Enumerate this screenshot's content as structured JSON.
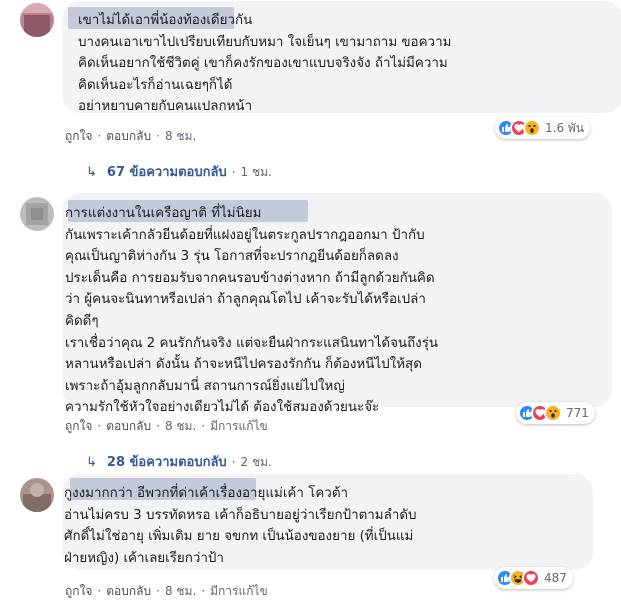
{
  "comments": [
    {
      "text": "เขาไม่ได้เอาพี่น้องท้องเดียวกัน\nบางคนเอาเขาไปเปรียบเทียบกับหมา ใจเย็นๆ เขามาถาม ขอความ\nคิดเห็นอยากใช้ชีวิตคู่ เขาก็คงรักของเขาแบบจริงจัง ถ้าไม่มีความ\nคิดเห็นอะไรก็อ่านเฉยๆก็ได้\nอย่าหยาบคายกับคนแปลกหน้า",
      "like": "ถูกใจ",
      "reply": "ตอบกลับ",
      "time": "8 ชม.",
      "edited": "",
      "reaction_count": "1.6 พัน",
      "reactions": [
        "like-icon",
        "love-icon",
        "wow-icon"
      ]
    },
    {
      "text": "การแต่งงานในเครือญาติ ที่ไม่นิยม\nกันเพราะเค้ากลัวยีนด้อยที่แฝงอยู่ในตระกูลปรากฎออกมา ป้ากับ\nคุณเป็นญาติห่างกัน 3 รุ่น โอกาสที่จะปรากฎยีนด้อยก็ลดลง\nประเด็นคือ การยอมรับจากคนรอบข้างต่างหาก ถ้ามีลูกด้วยกันคิด\nว่า ผู้คนจะนินทาหรือเปล่า ถ้าลูกคุณโตไป เค้าจะรับได้หรือเปล่า\nคิดดีๆ\nเราเชื่อว่าคุณ 2 คนรักกันจริง แต่จะยืนฝ่ากระแสนินทาได้จนถึงรุ่น\nหลานหรือเปล่า ดังนั้น ถ้าจะหนีไปครองรักกัน ก็ต้องหนีไปให้สุด\nเพราะถ้าอุ้มลูกกลับมานี่ สถานการณ์ยิ่งแย่ไปใหญ่\nความรักใช้หัวใจอย่างเดียวไม่ได้ ต้องใช้สมองด้วยนะจ๊ะ",
      "like": "ถูกใจ",
      "reply": "ตอบกลับ",
      "time": "8 ชม.",
      "edited": "มีการแก้ไข",
      "reaction_count": "771",
      "reactions": [
        "like-icon",
        "love-icon",
        "wow-icon"
      ]
    },
    {
      "text": "กูงงมากกว่า อีพวกที่ด่าเค้าเรื่องอายุแม่เค้า โควต้า\nอ่านไม่ครบ 3 บรรทัดหรอ เค้าก็อธิบายอยู่ว่าเรียกป้าตามลำดับ\nศักดิ์ไม่ใช่อายุ เพิ่มเติม ยาย จขกท เป็นน้องของยาย (ที่เป็นแม่\nฝ่ายหญิง) เค้าเลยเรียกว่าป้า",
      "like": "ถูกใจ",
      "reply": "ตอบกลับ",
      "time": "8 ชม.",
      "edited": "มีการแก้ไข",
      "reaction_count": "487",
      "reactions": [
        "like-icon",
        "haha-icon",
        "love-icon"
      ]
    }
  ],
  "reply_links": [
    {
      "label": "67 ข้อความตอบกลับ",
      "time": "1 ชม."
    },
    {
      "label": "28 ข้อความตอบกลับ",
      "time": "2 ชม."
    }
  ],
  "colors": {
    "like": "#2d88ff",
    "love": "#f33e58",
    "wow": "#f7b125",
    "link": "#385898"
  }
}
